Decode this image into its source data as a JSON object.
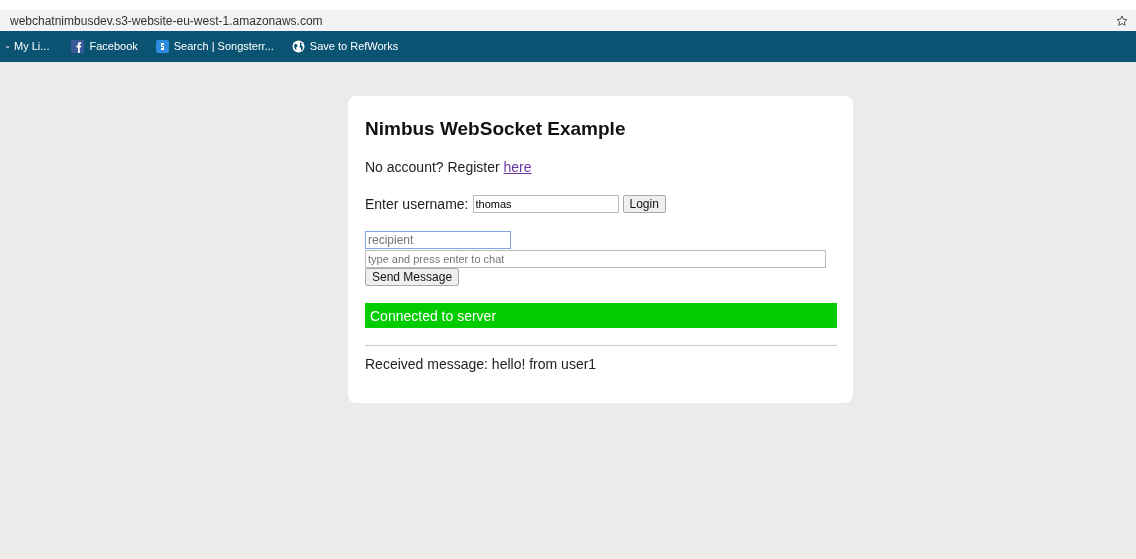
{
  "browser": {
    "address": "webchatnimbusdev.s3-website-eu-west-1.amazonaws.com",
    "bookmarked": false,
    "bookmarks": [
      {
        "label": "My Li...",
        "kind": "cut"
      },
      {
        "label": "Facebook",
        "kind": "facebook"
      },
      {
        "label": "Search | Songsterr...",
        "kind": "songsterr"
      },
      {
        "label": "Save to RefWorks",
        "kind": "globe"
      }
    ]
  },
  "card": {
    "title": "Nimbus WebSocket Example",
    "register": {
      "text": "No account? Register",
      "link": "here"
    },
    "username": {
      "label": "Enter username:",
      "value": "thomas",
      "button": "Login"
    },
    "recipient": {
      "placeholder": "recipient",
      "focused": true
    },
    "message": {
      "placeholder": "type and press enter to chat"
    },
    "send_button": "Send Message",
    "status": {
      "text": "Connected to server",
      "connected": true
    },
    "received": "Received message: hello! from user1"
  }
}
